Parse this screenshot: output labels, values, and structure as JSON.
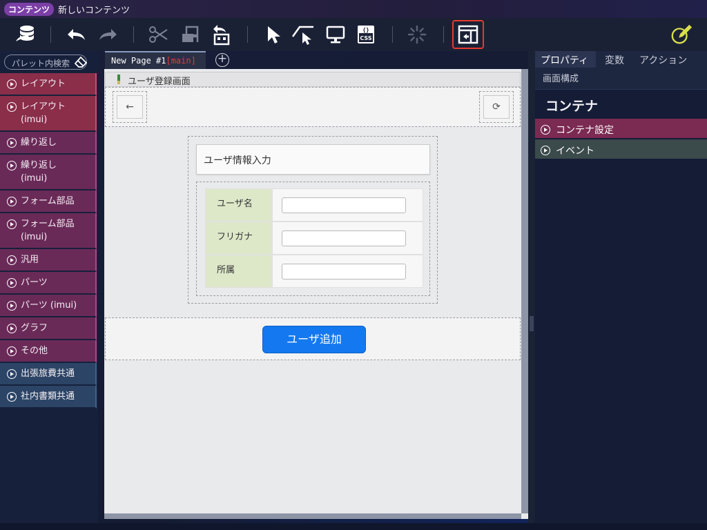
{
  "titlebar": {
    "badge": "コンテンツ",
    "title": "新しいコンテンツ"
  },
  "toolbar": {
    "items": [
      "database-export-icon",
      "undo-icon",
      "redo-icon",
      "cut-icon",
      "copy-icon",
      "paste-icon",
      "pointer-icon",
      "select-area-icon",
      "preview-icon",
      "css-icon",
      "spinner-icon",
      "panel-toggle-icon",
      "edit-icon"
    ],
    "css_label": "CSS",
    "css_braces": "{}",
    "accent": "#e8392e"
  },
  "palette": {
    "search_placeholder": "パレット内検索",
    "items": [
      {
        "label": "レイアウト",
        "sub": "",
        "color": "red"
      },
      {
        "label": "レイアウト",
        "sub": "(imui)",
        "color": "red"
      },
      {
        "label": "繰り返し",
        "sub": "",
        "color": "purple"
      },
      {
        "label": "繰り返し",
        "sub": "(imui)",
        "color": "purple"
      },
      {
        "label": "フォーム部品",
        "sub": "",
        "color": "purple"
      },
      {
        "label": "フォーム部品",
        "sub": "(imui)",
        "color": "purple"
      },
      {
        "label": "汎用",
        "sub": "",
        "color": "purple"
      },
      {
        "label": "パーツ",
        "sub": "",
        "color": "purple"
      },
      {
        "label": "パーツ (imui)",
        "sub": "",
        "color": "purple"
      },
      {
        "label": "グラフ",
        "sub": "",
        "color": "purple"
      },
      {
        "label": "その他",
        "sub": "",
        "color": "purple"
      },
      {
        "label": "出張旅費共通",
        "sub": "",
        "color": "blue"
      },
      {
        "label": "社内書類共通",
        "sub": "",
        "color": "blue"
      }
    ]
  },
  "canvas": {
    "tab_label": "New Page #1",
    "tab_suffix": "[main]",
    "add_tab": "+",
    "header": "ユーザ登録画面",
    "back_icon": "←",
    "reload_icon": "⟳",
    "panel_title": "ユーザ情報入力",
    "rows": [
      {
        "label": "ユーザ名",
        "value": ""
      },
      {
        "label": "フリガナ",
        "value": ""
      },
      {
        "label": "所属",
        "value": ""
      }
    ],
    "button": "ユーザ追加"
  },
  "properties": {
    "tabs": [
      "プロパティ",
      "変数",
      "アクション"
    ],
    "sub": "画面構成",
    "title": "コンテナ",
    "sections": [
      "コンテナ設定",
      "イベント"
    ]
  }
}
